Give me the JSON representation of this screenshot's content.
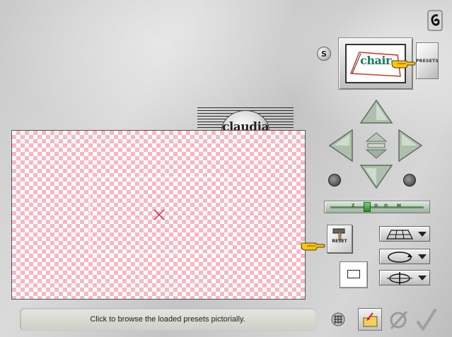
{
  "status": {
    "message": "Click to browse the loaded presets pictorially."
  },
  "toolbar": {
    "s_label": "S",
    "presets_label": "PRESETS",
    "reset_label": "RESET"
  },
  "preset_thumbnail": {
    "text": "chair"
  },
  "watermark": {
    "text": "claudia",
    "subtext": "claudia"
  },
  "zoom_slider": {
    "labels": [
      "Z",
      "O",
      "O",
      "M"
    ]
  },
  "icons": {
    "corner": "app-logo-icon",
    "up": "arrow-up-icon",
    "down": "arrow-down-icon",
    "left": "arrow-left-icon",
    "right": "arrow-right-icon",
    "center": "center-arrows-icon",
    "rotate_left": "rotate-left-knob-icon",
    "rotate_right": "rotate-right-knob-icon",
    "grid": "grid-icon",
    "folder": "open-folder-icon",
    "cancel": "cancel-icon",
    "ok": "ok-checkmark-icon",
    "hammer": "hammer-icon",
    "perspective": "perspective-grid-icon",
    "rotate_loop": "rotate-loop-icon",
    "flip": "flip-axis-icon",
    "hand": "pointing-hand-icon",
    "crosshair": "crosshair-icon"
  },
  "colors": {
    "checker_pink": "#f6b8c4",
    "arrow_green": "#aebfae",
    "status_bg": "#dcdcd5"
  }
}
